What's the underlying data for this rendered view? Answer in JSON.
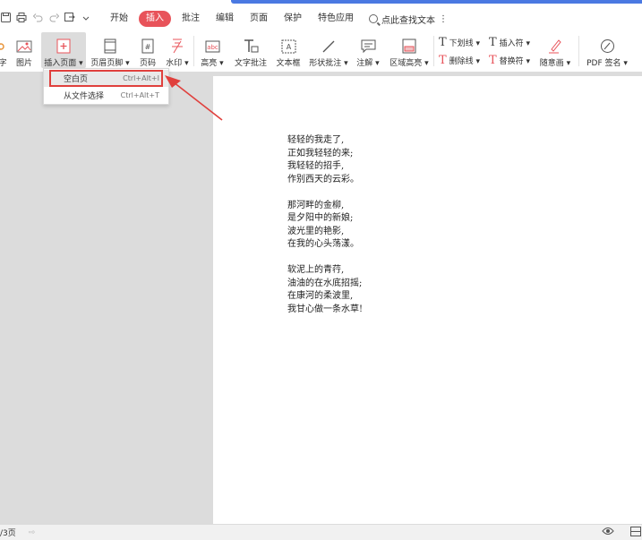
{
  "menubar": {
    "items": [
      "开始",
      "插入",
      "批注",
      "编辑",
      "页面",
      "保护",
      "特色应用"
    ],
    "active": "插入",
    "search_label": "点此查找文本"
  },
  "ribbon": {
    "left_cut_label": "字",
    "picture": "图片",
    "insert_page": "插入页面",
    "header_footer": "页眉页脚",
    "page_number": "页码",
    "watermark": "水印",
    "highlight": "高亮",
    "text_comment": "文字批注",
    "text_box": "文本框",
    "shape_comment": "形状批注",
    "note": "注解",
    "area_highlight": "区域高亮",
    "underline": "下划线",
    "strikethrough": "删除线",
    "insert_symbol": "插入符",
    "replace_symbol": "替换符",
    "freehand": "随意画",
    "pdf_sign": "PDF 签名"
  },
  "dropdown": {
    "items": [
      {
        "label": "空白页",
        "shortcut": "Ctrl+Alt+I"
      },
      {
        "label": "从文件选择",
        "shortcut": "Ctrl+Alt+T"
      }
    ]
  },
  "poem": {
    "stanzas": [
      [
        "轻轻的我走了,",
        "正如我轻轻的来;",
        "我轻轻的招手,",
        "作别西天的云彩。"
      ],
      [
        "那河畔的金柳,",
        "是夕阳中的新娘;",
        "波光里的艳影,",
        "在我的心头荡漾。"
      ],
      [
        "软泥上的青荇,",
        "油油的在水底招摇;",
        "在康河的柔波里,",
        "我甘心做一条水草!"
      ]
    ]
  },
  "status": {
    "page_info": "/3页"
  },
  "colors": {
    "accent_red": "#e8535a",
    "highlight_red": "#e0403d",
    "top_blue": "#4a79e2"
  }
}
